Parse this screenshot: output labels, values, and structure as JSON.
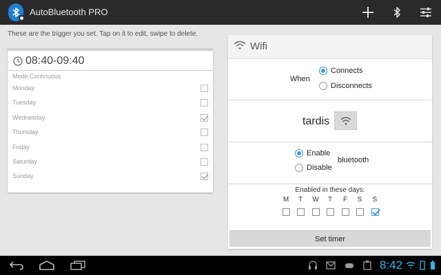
{
  "app": {
    "title": "AutoBluetooth PRO",
    "icon": "bluetooth-icon"
  },
  "actionbar": {
    "actions": [
      "add-icon",
      "bluetooth-icon",
      "settings-sliders-icon"
    ]
  },
  "left": {
    "hint": "These are the trigger you set. Tap on it to edit, swipe to delete.",
    "trigger": {
      "time": "08:40-09:40",
      "mode": "Mode:Continuous",
      "days": [
        {
          "label": "Monday",
          "checked": false
        },
        {
          "label": "Tuesday",
          "checked": false
        },
        {
          "label": "Wednesday",
          "checked": true
        },
        {
          "label": "Thursday",
          "checked": false
        },
        {
          "label": "Friday",
          "checked": false
        },
        {
          "label": "Saturday",
          "checked": false
        },
        {
          "label": "Sunday",
          "checked": true
        }
      ]
    }
  },
  "right": {
    "title": "Wifi",
    "when_label": "When",
    "when_options": [
      {
        "label": "Connects",
        "selected": true
      },
      {
        "label": "Disconnects",
        "selected": false
      }
    ],
    "ssid": "tardis",
    "action_options": [
      {
        "label": "Enable",
        "selected": true
      },
      {
        "label": "Disable",
        "selected": false
      }
    ],
    "action_target": "bluetooth",
    "days_label": "Enabled in these days:",
    "days": [
      {
        "letter": "M",
        "checked": false
      },
      {
        "letter": "T",
        "checked": false
      },
      {
        "letter": "W",
        "checked": false
      },
      {
        "letter": "T",
        "checked": false
      },
      {
        "letter": "F",
        "checked": false
      },
      {
        "letter": "S",
        "checked": false
      },
      {
        "letter": "S",
        "checked": true
      }
    ],
    "set_timer": "Set timer"
  },
  "sysbar": {
    "clock": "8:42",
    "accent": "#33b5e5"
  }
}
